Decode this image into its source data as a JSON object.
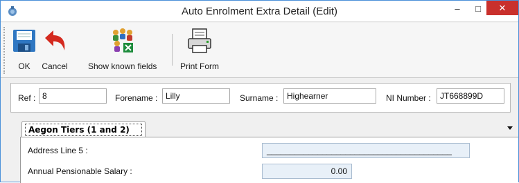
{
  "window": {
    "title": "Auto Enrolment Extra Detail (Edit)",
    "controls": {
      "minimize": "–",
      "maximize": "□",
      "close": "✕"
    },
    "accent": "#c9302c"
  },
  "toolbar": {
    "ok_label": "OK",
    "cancel_label": "Cancel",
    "show_fields_label": "Show known fields",
    "print_label": "Print Form"
  },
  "fields": {
    "ref_label": "Ref :",
    "ref_value": "8",
    "forename_label": "Forename :",
    "forename_value": "Lilly",
    "surname_label": "Surname :",
    "surname_value": "Highearner",
    "ni_label": "NI Number :",
    "ni_value": "JT668899D"
  },
  "tabs": [
    {
      "label": "Aegon Tiers (1 and 2)",
      "active": true
    }
  ],
  "detail": {
    "address5_label": "Address Line 5   :",
    "address5_value": "________________________________________",
    "salary_label": "Annual Pensionable Salary     :",
    "salary_value": "0.00"
  }
}
